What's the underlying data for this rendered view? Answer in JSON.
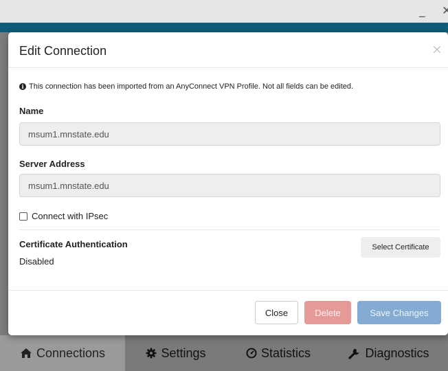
{
  "window": {
    "minimize_glyph": "_",
    "close_glyph": "✕"
  },
  "modal": {
    "title": "Edit Connection",
    "close_glyph": "×",
    "notice_icon": "info-circle-icon",
    "notice": "This connection has been imported from an AnyConnect VPN Profile. Not all fields can be edited.",
    "name_label": "Name",
    "name_value": "msum1.mnstate.edu",
    "server_label": "Server Address",
    "server_value": "msum1.mnstate.edu",
    "ipsec_label": "Connect with IPsec",
    "ipsec_checked": false,
    "cert_label": "Certificate Authentication",
    "cert_value": "Disabled",
    "select_cert_label": "Select Certificate",
    "buttons": {
      "close": "Close",
      "delete": "Delete",
      "save": "Save Changes"
    }
  },
  "tabs": [
    {
      "label": "Connections",
      "icon": "home-icon",
      "active": true
    },
    {
      "label": "Settings",
      "icon": "gear-icon",
      "active": false
    },
    {
      "label": "Statistics",
      "icon": "gauge-icon",
      "active": false
    },
    {
      "label": "Diagnostics",
      "icon": "wrench-icon",
      "active": false
    }
  ],
  "colors": {
    "header": "#0f5c79",
    "delete": "#e69a98",
    "save": "#84acd3"
  }
}
